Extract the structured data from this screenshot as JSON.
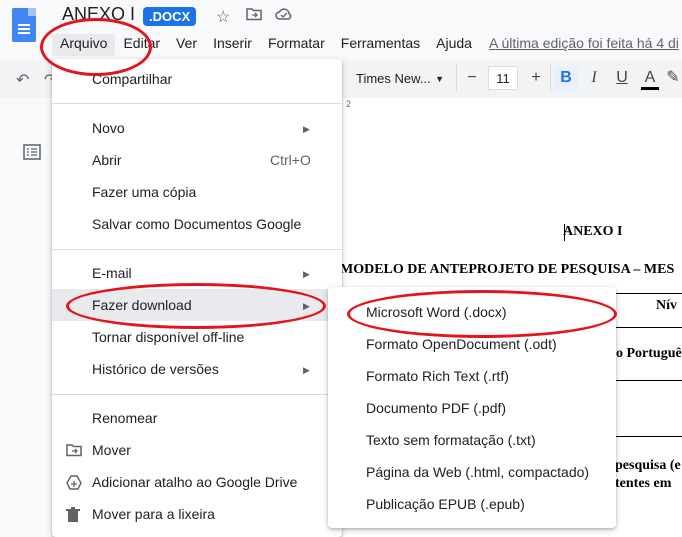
{
  "header": {
    "doc_title": "ANEXO I",
    "badge": ".DOCX",
    "star_icon": "star-icon",
    "move_icon": "folder-move-icon",
    "cloud_icon": "cloud-status-icon"
  },
  "menubar": {
    "items": [
      "Arquivo",
      "Editar",
      "Ver",
      "Inserir",
      "Formatar",
      "Ferramentas",
      "Ajuda"
    ],
    "last_edit": "A última edição foi feita há 4 di"
  },
  "toolbar": {
    "font": "Times New...",
    "font_size": "11",
    "minus": "−",
    "plus": "+",
    "bold": "B",
    "italic": "I",
    "underline": "U",
    "text_color": "A",
    "pen": "✎",
    "ruler_mark": "2"
  },
  "file_menu": {
    "share": "Compartilhar",
    "new": "Novo",
    "open": "Abrir",
    "open_shortcut": "Ctrl+O",
    "copy": "Fazer uma cópia",
    "save_as_docs": "Salvar como Documentos Google",
    "email": "E-mail",
    "download": "Fazer download",
    "offline": "Tornar disponível off-line",
    "history": "Histórico de versões",
    "rename": "Renomear",
    "move": "Mover",
    "shortcut": "Adicionar atalho ao Google Drive",
    "trash": "Mover para a lixeira"
  },
  "download_submenu": {
    "items": [
      "Microsoft Word (.docx)",
      "Formato OpenDocument (.odt)",
      "Formato Rich Text (.rtf)",
      "Documento PDF (.pdf)",
      "Texto sem formatação (.txt)",
      "Página da Web (.html, compactado)",
      "Publicação EPUB (.epub)"
    ]
  },
  "document": {
    "heading": "ANEXO I",
    "subheading": "MODELO DE ANTEPROJETO DE PESQUISA – MES",
    "cell_nivel": "Nív",
    "cell_portugues": "o Portuguê",
    "cell_pesquisa": "pesquisa (e",
    "cell_tentes": "tentes em"
  }
}
